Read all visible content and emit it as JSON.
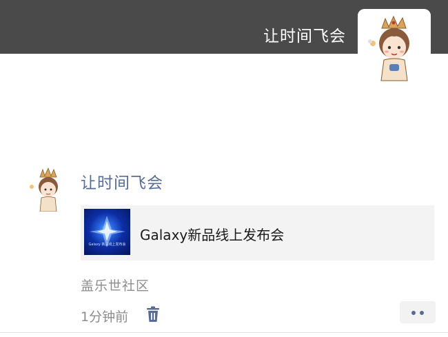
{
  "profile": {
    "name": "让时间飞会",
    "cover_color": "#4a4a4a"
  },
  "post": {
    "nickname": "让时间飞会",
    "link_card": {
      "title": "Galaxy新品线上发布会",
      "thumbnail_caption": "Galaxy 新品线上发布会"
    },
    "source": "盖乐世社区",
    "time": "1分钟前",
    "delete_icon": "trash-icon",
    "more_icon": "more-dots-icon"
  },
  "colors": {
    "nickname": "#576b95",
    "secondary_text": "#8c8c8c",
    "card_bg": "#f3f3f3"
  }
}
